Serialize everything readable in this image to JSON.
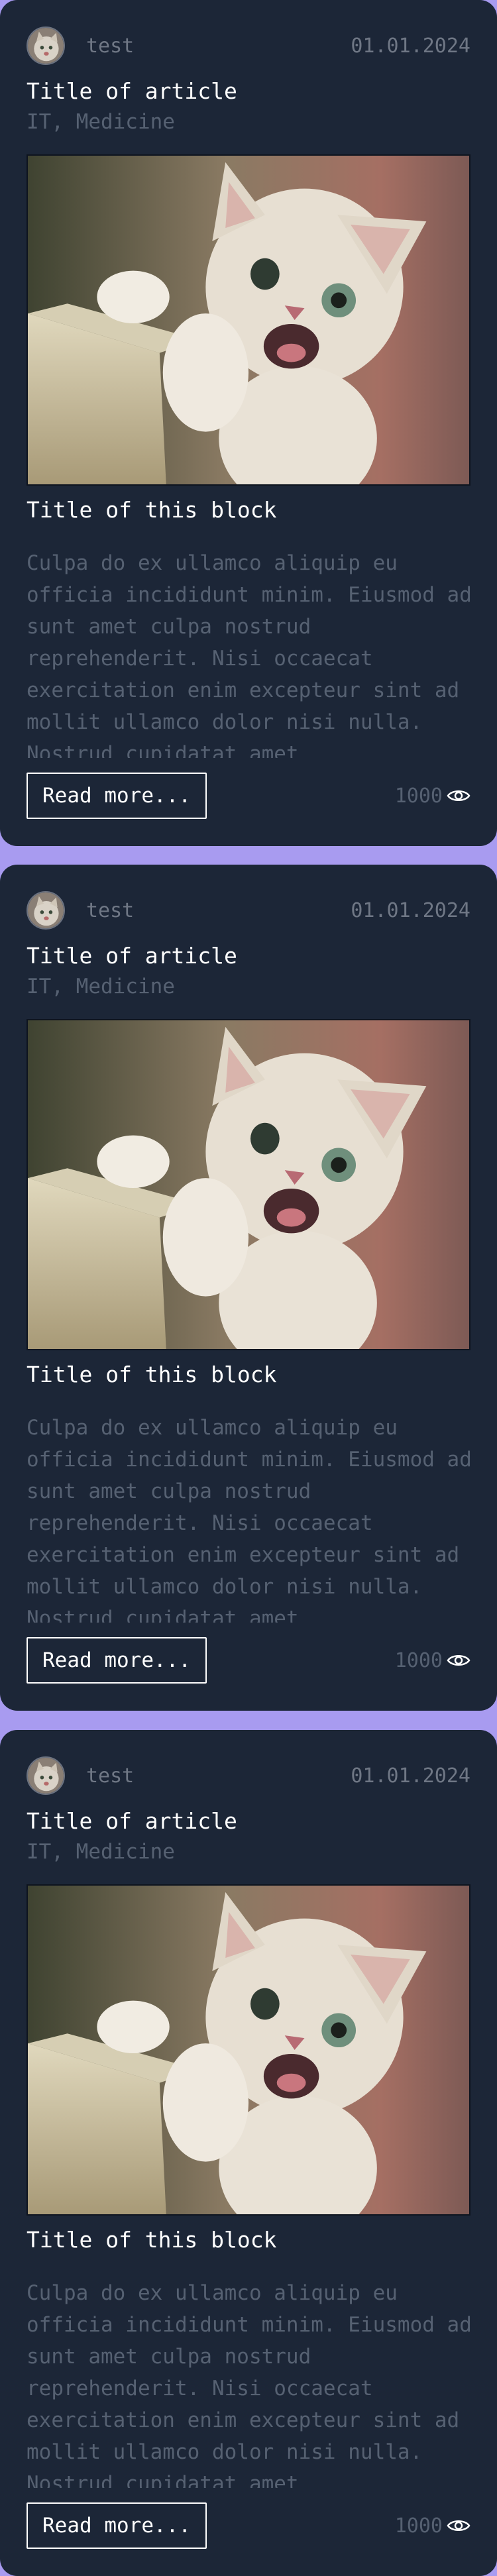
{
  "cards": [
    {
      "author": "test",
      "date": "01.01.2024",
      "article_title": "Title of article",
      "tags": "IT, Medicine",
      "block_title": "Title of this block",
      "block_text": "Culpa do ex ullamco aliquip eu officia incididunt minim. Eiusmod ad sunt amet culpa nostrud reprehenderit. Nisi occaecat exercitation enim excepteur sint ad mollit ullamco dolor nisi nulla. Nostrud cupidatat amet",
      "read_more_label": "Read more...",
      "views": "1000",
      "views_icon": "eye-icon"
    },
    {
      "author": "test",
      "date": "01.01.2024",
      "article_title": "Title of article",
      "tags": "IT, Medicine",
      "block_title": "Title of this block",
      "block_text": "Culpa do ex ullamco aliquip eu officia incididunt minim. Eiusmod ad sunt amet culpa nostrud reprehenderit. Nisi occaecat exercitation enim excepteur sint ad mollit ullamco dolor nisi nulla. Nostrud cupidatat amet",
      "read_more_label": "Read more...",
      "views": "1000",
      "views_icon": "eye-icon"
    },
    {
      "author": "test",
      "date": "01.01.2024",
      "article_title": "Title of article",
      "tags": "IT, Medicine",
      "block_title": "Title of this block",
      "block_text": "Culpa do ex ullamco aliquip eu officia incididunt minim. Eiusmod ad sunt amet culpa nostrud reprehenderit. Nisi occaecat exercitation enim excepteur sint ad mollit ullamco dolor nisi nulla. Nostrud cupidatat amet",
      "read_more_label": "Read more...",
      "views": "1000",
      "views_icon": "eye-icon"
    }
  ],
  "colors": {
    "page_background": "#a89bf0",
    "card_background": "#1c2637",
    "muted_text": "#566172",
    "title_text": "#ffffff"
  }
}
